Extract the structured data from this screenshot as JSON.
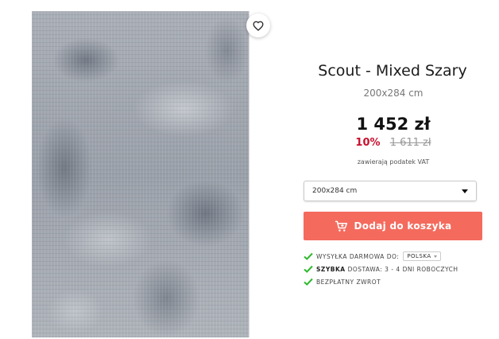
{
  "product": {
    "title": "Scout - Mixed Szary",
    "size": "200x284 cm",
    "price": "1 452 zł",
    "discount": "10%",
    "old_price": "1 611 zł",
    "vat_note": "zawierają podatek VAT"
  },
  "size_select": {
    "selected": "200x284 cm"
  },
  "cart_button": {
    "label": "Dodaj do koszyka",
    "icon": "cart-icon"
  },
  "favorite": {
    "icon": "heart-icon"
  },
  "perks": {
    "shipping": {
      "label": "Wysyłka darmowa do:",
      "country": "POLSKA"
    },
    "delivery": {
      "bold": "Szybka",
      "label": "dostawa: 3 - 4 dni roboczych"
    },
    "returns": {
      "label": "Bezpłatny zwrot"
    }
  },
  "colors": {
    "accent": "#f46b5e",
    "discount": "#c8102e",
    "check": "#2eb82e"
  }
}
